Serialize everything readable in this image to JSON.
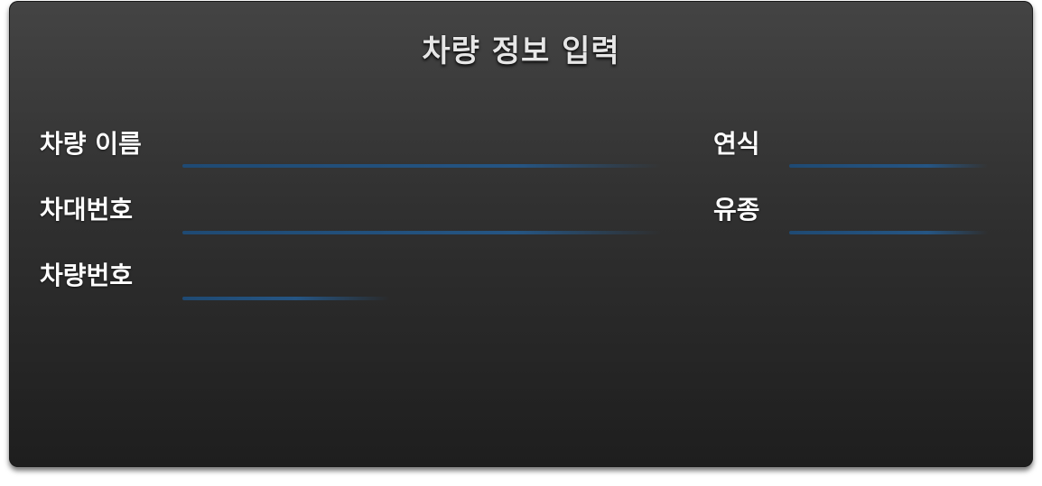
{
  "form": {
    "title": "차량 정보 입력",
    "fields": [
      {
        "label": "차량 이름",
        "value": ""
      },
      {
        "label": "차대번호",
        "value": ""
      },
      {
        "label": "차량번호",
        "value": ""
      },
      {
        "label": "연식",
        "value": ""
      },
      {
        "label": "유종",
        "value": ""
      }
    ]
  },
  "colors": {
    "underline": "#255583",
    "panel_top": "#444444",
    "panel_bottom": "#1e1e1e",
    "label_text": "#ffffff"
  }
}
